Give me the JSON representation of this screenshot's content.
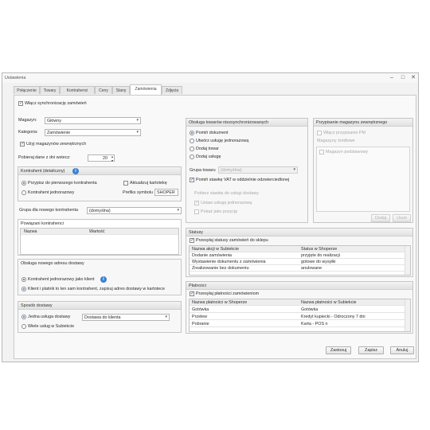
{
  "window": {
    "title": "Ustawienia"
  },
  "tabs": [
    "Połączenie",
    "Towary",
    "Kontrahenci",
    "Ceny",
    "Stany",
    "Zamówienia",
    "Zdjęcia"
  ],
  "enable_sync": "Włącz synchronizację zamówień",
  "left": {
    "warehouse_label": "Magazyn:",
    "warehouse_value": "Główny",
    "category_label": "Kategoria:",
    "category_value": "Zamówienie",
    "use_warehouse_check": "Użyj magazynów zewnętrznych",
    "days_label": "Pobieraj dane z dni wstecz:",
    "days_value": "20",
    "contractor_group": {
      "title": "Kontrahent (detaliczny)",
      "radio1": "Przypisz do pierwszego kontrahenta",
      "radio2": "Kontrahent jednorazowy",
      "update_check": "Aktualizuj kartotekę",
      "prefix_label": "Prefiks symbolu",
      "prefix_value": "SHOPER"
    },
    "new_group_label": "Grupa dla nowego kontrahenta",
    "new_group_value": "(domyślna)",
    "related": {
      "title": "Powiązani kontrahenci",
      "col_name": "Nazwa",
      "col_value": "Wartość"
    },
    "delivery_addr": {
      "title": "Obsługa nowego adresu dostawy",
      "radio1": "Kontrahent jednorazowy jako klient",
      "radio2": "Klient i platnik to ten sam kontrahent, zapisuj adres dostawy w kartotece"
    },
    "shipping": {
      "title": "Sposób dostawy",
      "delivery_method_label": "Jedna usługa dostawy",
      "delivery_method_value": "Dostawa do klienta",
      "multiple_label": "Wiele usług w Subiekcie"
    }
  },
  "mid": {
    "title": "Obsługa towarów niezsynchronizowanych",
    "r1": "Pomiń dokument",
    "r2": "Utwórz usługę jednorazową",
    "r3": "Dodaj towar",
    "r4": "Dodaj usługę",
    "group_label": "Grupa towaru",
    "group_value": "(domyślna)",
    "check1": "Pomiń stawkę VAT w oddzielnie odzwierciedlonej",
    "sub_label": "Pobierz stawkę do usługi dostawy",
    "sub_check1": "Ustaw usługę jednorazową",
    "sub_check2": "Pokaż jako pozycję"
  },
  "right": {
    "title": "Przypisanie magazynu zewnętrznego",
    "check": "Włącz przypisanie PM",
    "list_label": "Magazyny źródłowe",
    "item": "Magazyn podstawowy",
    "btn_add": "Dodaj",
    "btn_del": "Usuń"
  },
  "statuses": {
    "title": "Statusy",
    "check": "Przesyłaj statusy zamówień do sklepu",
    "col1": "Nazwa akcji w Subiekcie",
    "col2": "Status w Shoperze",
    "rows": [
      {
        "a": "Dodanie zamówienia",
        "b": "przyjęte do realizacji"
      },
      {
        "a": "Wystawienie dokumentu z zamówienia",
        "b": "gotowe do wysyłki"
      },
      {
        "a": "Zrealizowanie bez dokumentu",
        "b": "anulowane"
      }
    ]
  },
  "payments": {
    "title": "Płatności",
    "check": "Przesyłaj płatności zamówieniom",
    "col1": "Nazwa płatności w Shoperze",
    "col2": "Nazwa płatności w Subiekcie",
    "rows": [
      {
        "a": "Gotówka",
        "b": "Gotówka"
      },
      {
        "a": "Przelew",
        "b": "Kredyt kupiecki - Odroczony 7 dni"
      },
      {
        "a": "Pobranie",
        "b": "Karta - POS n"
      }
    ]
  },
  "footer": {
    "ok": "Zastosuj",
    "cancel": "Zapisz",
    "close": "Anuluj"
  }
}
